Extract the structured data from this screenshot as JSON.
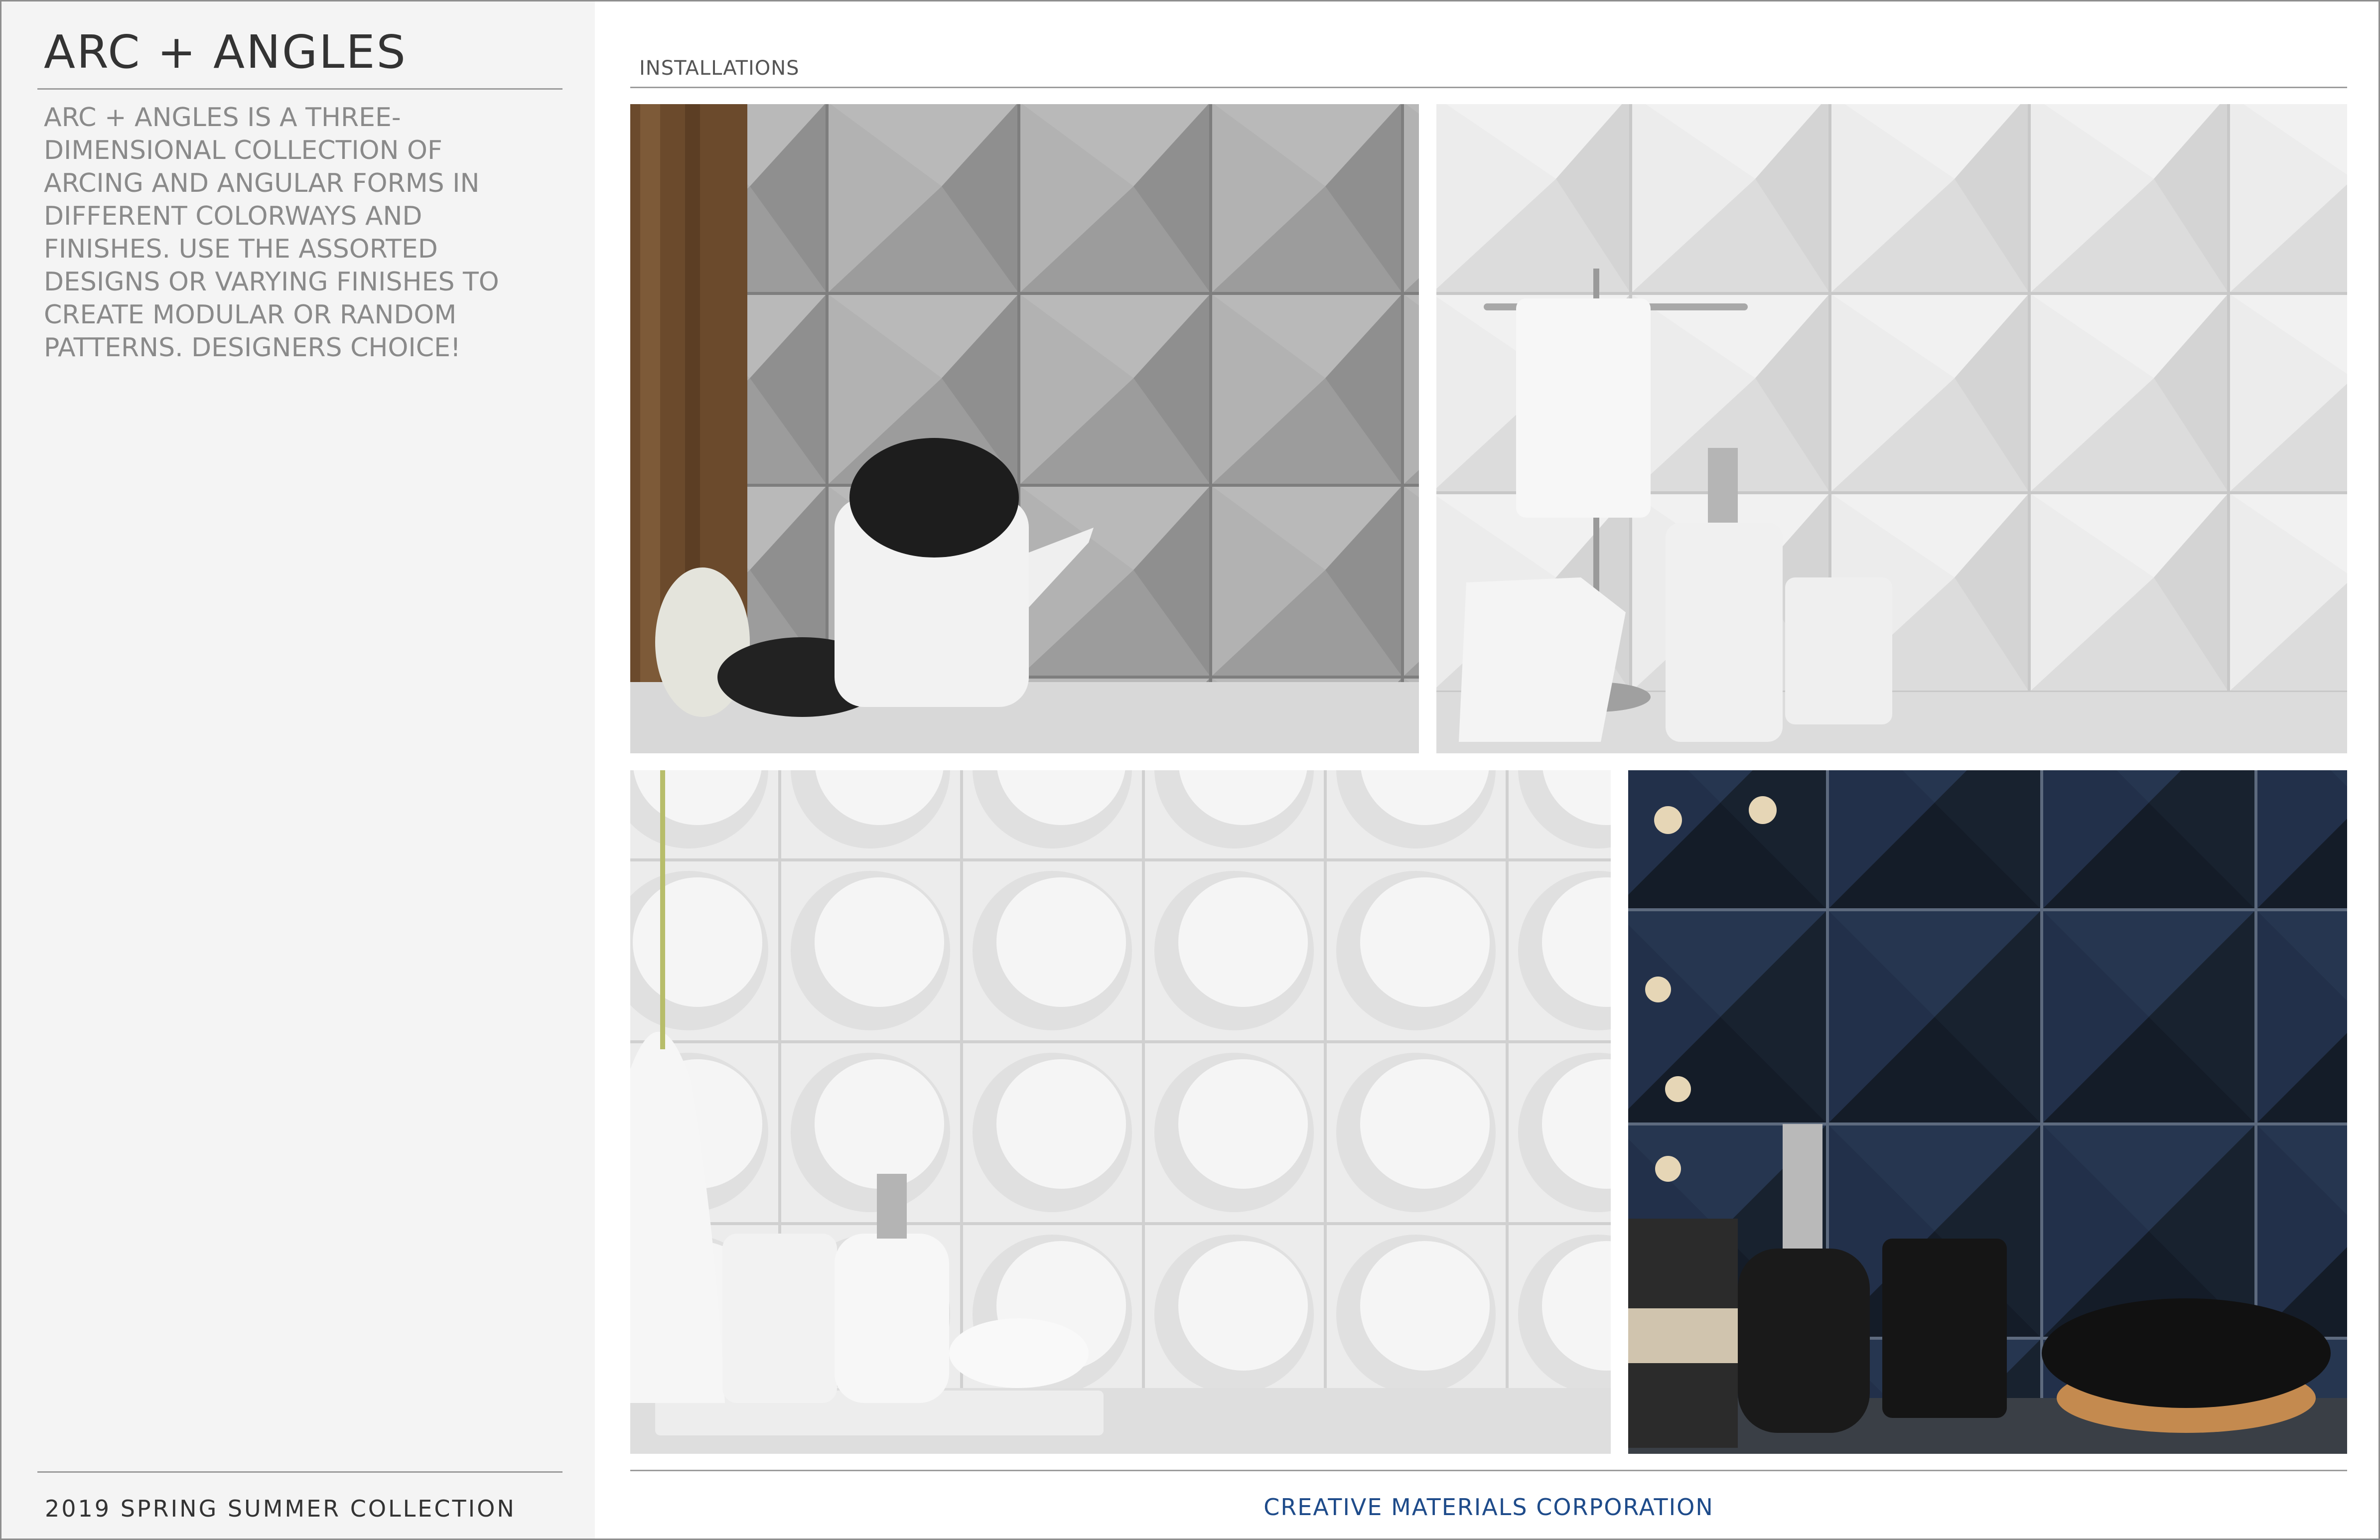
{
  "sidebar": {
    "title": "ARC + ANGLES",
    "description": "ARC + ANGLES IS A THREE-DIMENSIONAL COLLECTION OF ARCING AND ANGULAR FORMS IN DIFFERENT COLORWAYS AND FINISHES. USE THE ASSORTED DESIGNS OR VARYING FINISHES TO CREATE MODULAR OR RANDOM PATTERNS. DESIGNERS CHOICE!",
    "footer": "2019 SPRING SUMMER COLLECTION"
  },
  "main": {
    "section_label": "INSTALLATIONS",
    "footer": "CREATIVE MATERIALS CORPORATION",
    "footer_color": "#1e4b8a"
  },
  "photos": [
    {
      "name": "gray-angular-tile-kitchen-photo",
      "wall_color": "#a7a7a7"
    },
    {
      "name": "white-angular-tile-bathroom-photo",
      "wall_color": "#e6e6e6"
    },
    {
      "name": "white-arc-tile-bathroom-photo",
      "wall_color": "#ececec"
    },
    {
      "name": "navy-angular-tile-bathroom-photo",
      "wall_color": "#1b2638"
    }
  ]
}
